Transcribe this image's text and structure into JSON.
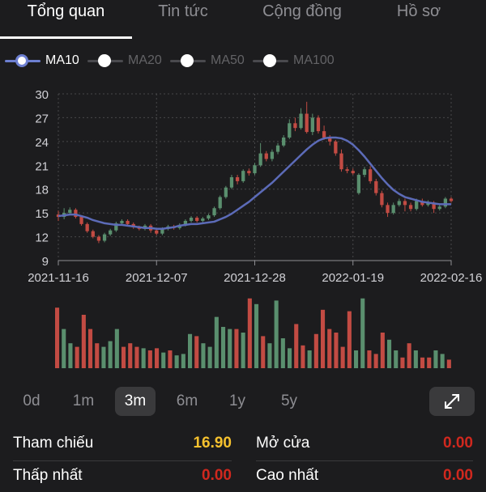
{
  "tabs": [
    {
      "label": "Tổng quan",
      "active": true
    },
    {
      "label": "Tin tức",
      "active": false
    },
    {
      "label": "Cộng đồng",
      "active": false
    },
    {
      "label": "Hồ sơ",
      "active": false
    }
  ],
  "legend": [
    {
      "label": "MA10",
      "on": true
    },
    {
      "label": "MA20",
      "on": false
    },
    {
      "label": "MA50",
      "on": false
    },
    {
      "label": "MA100",
      "on": false
    }
  ],
  "colors": {
    "up": "#5a8f6e",
    "down": "#c24b43",
    "ma": "#5c6bb8",
    "accent_yellow": "#f5c12e",
    "value_red": "#d0281e"
  },
  "chart_data": {
    "type": "candlestick",
    "y_ticks": [
      9,
      12,
      15,
      18,
      21,
      24,
      27,
      30
    ],
    "ylim": [
      9,
      30
    ],
    "x_tick_labels": [
      "2021-11-16",
      "2021-12-07",
      "2021-12-28",
      "2022-01-19",
      "2022-02-16"
    ],
    "grid": true,
    "candles": [
      [
        14.8,
        14.5,
        15.3,
        14.0
      ],
      [
        14.5,
        15.0,
        15.6,
        14.2
      ],
      [
        15.0,
        15.4,
        15.7,
        14.8
      ],
      [
        15.4,
        14.5,
        15.6,
        14.3
      ],
      [
        14.5,
        13.6,
        14.7,
        13.4
      ],
      [
        13.6,
        12.7,
        13.8,
        12.5
      ],
      [
        12.7,
        12.0,
        12.9,
        11.8
      ],
      [
        12.0,
        11.5,
        12.2,
        11.2
      ],
      [
        11.5,
        12.3,
        12.5,
        11.3
      ],
      [
        12.3,
        12.8,
        13.0,
        12.1
      ],
      [
        12.8,
        13.7,
        13.9,
        12.6
      ],
      [
        13.7,
        14.0,
        14.2,
        13.4
      ],
      [
        14.0,
        13.6,
        14.2,
        13.4
      ],
      [
        13.6,
        13.2,
        13.8,
        13.0
      ],
      [
        13.2,
        13.0,
        13.4,
        12.8
      ],
      [
        13.0,
        13.4,
        13.6,
        12.8
      ],
      [
        13.4,
        12.8,
        13.6,
        12.5
      ],
      [
        12.8,
        12.4,
        13.0,
        12.2
      ],
      [
        12.4,
        13.0,
        13.2,
        12.2
      ],
      [
        13.0,
        13.3,
        13.5,
        12.8
      ],
      [
        13.3,
        13.1,
        13.5,
        12.9
      ],
      [
        13.1,
        13.5,
        13.7,
        12.9
      ],
      [
        13.5,
        14.0,
        14.2,
        13.3
      ],
      [
        14.0,
        14.4,
        14.6,
        13.8
      ],
      [
        14.4,
        14.0,
        14.6,
        13.8
      ],
      [
        14.0,
        14.3,
        14.5,
        13.8
      ],
      [
        14.3,
        14.7,
        14.9,
        14.1
      ],
      [
        14.7,
        15.6,
        15.8,
        14.5
      ],
      [
        15.6,
        17.0,
        17.2,
        15.4
      ],
      [
        17.0,
        18.2,
        18.4,
        16.8
      ],
      [
        18.2,
        19.5,
        19.8,
        18.0
      ],
      [
        19.5,
        19.0,
        19.8,
        18.6
      ],
      [
        19.0,
        20.3,
        20.5,
        18.8
      ],
      [
        20.3,
        20.0,
        20.6,
        19.7
      ],
      [
        20.0,
        21.0,
        21.3,
        19.8
      ],
      [
        21.0,
        22.5,
        23.8,
        20.8
      ],
      [
        22.5,
        21.8,
        22.8,
        21.5
      ],
      [
        21.8,
        22.7,
        23.0,
        21.5
      ],
      [
        22.7,
        23.5,
        23.8,
        22.4
      ],
      [
        23.5,
        24.5,
        24.8,
        23.3
      ],
      [
        24.5,
        26.3,
        26.8,
        24.3
      ],
      [
        26.3,
        25.7,
        27.0,
        25.3
      ],
      [
        25.7,
        27.5,
        28.2,
        25.5
      ],
      [
        27.5,
        25.2,
        29.0,
        25.0
      ],
      [
        25.2,
        27.0,
        27.5,
        24.8
      ],
      [
        27.0,
        25.3,
        27.3,
        25.0
      ],
      [
        25.3,
        24.5,
        26.0,
        24.2
      ],
      [
        24.5,
        24.0,
        24.8,
        23.5
      ],
      [
        24.0,
        22.5,
        24.2,
        22.2
      ],
      [
        22.5,
        20.5,
        23.0,
        20.2
      ],
      [
        20.5,
        20.3,
        20.8,
        20.0
      ],
      [
        20.3,
        20.0,
        20.6,
        19.8
      ],
      [
        17.5,
        19.8,
        20.0,
        17.3
      ],
      [
        19.8,
        20.5,
        20.8,
        19.5
      ],
      [
        20.5,
        19.0,
        20.9,
        18.7
      ],
      [
        19.0,
        17.5,
        19.3,
        17.2
      ],
      [
        17.5,
        16.0,
        17.8,
        15.7
      ],
      [
        16.0,
        15.0,
        16.3,
        14.5
      ],
      [
        15.0,
        16.0,
        16.3,
        14.8
      ],
      [
        16.0,
        16.5,
        16.8,
        15.8
      ],
      [
        16.5,
        16.0,
        16.8,
        15.2
      ],
      [
        16.0,
        15.5,
        16.3,
        15.2
      ],
      [
        15.5,
        16.5,
        16.8,
        15.3
      ],
      [
        16.5,
        16.0,
        16.8,
        15.8
      ],
      [
        16.0,
        16.3,
        16.6,
        15.8
      ],
      [
        16.3,
        15.5,
        16.5,
        15.0
      ],
      [
        15.5,
        15.8,
        16.2,
        15.3
      ],
      [
        15.8,
        16.8,
        17.0,
        15.6
      ],
      [
        16.8,
        16.5,
        17.0,
        16.3
      ]
    ],
    "ma10": [
      14.6,
      14.7,
      14.8,
      14.8,
      14.6,
      14.4,
      14.1,
      13.9,
      13.7,
      13.6,
      13.5,
      13.5,
      13.4,
      13.3,
      13.2,
      13.1,
      13.1,
      13.0,
      13.0,
      13.1,
      13.2,
      13.4,
      13.5,
      13.6,
      13.6,
      13.7,
      13.8,
      13.9,
      14.2,
      14.5,
      14.9,
      15.4,
      15.9,
      16.4,
      17.0,
      17.6,
      18.2,
      18.8,
      19.5,
      20.2,
      20.9,
      21.6,
      22.3,
      23.0,
      23.6,
      24.1,
      24.4,
      24.5,
      24.5,
      24.4,
      24.1,
      23.6,
      22.9,
      22.1,
      21.2,
      20.3,
      19.4,
      18.6,
      17.9,
      17.4,
      17.0,
      16.8,
      16.6,
      16.4,
      16.3,
      16.2,
      16.1,
      16.1,
      16.1
    ],
    "volume": [
      0.85,
      0.55,
      0.35,
      0.3,
      0.75,
      0.55,
      0.35,
      0.3,
      0.38,
      0.55,
      0.3,
      0.35,
      0.3,
      0.28,
      0.25,
      0.28,
      0.22,
      0.25,
      0.18,
      0.2,
      0.48,
      0.45,
      0.35,
      0.3,
      0.72,
      0.58,
      0.55,
      0.55,
      0.5,
      0.98,
      0.9,
      0.45,
      0.35,
      0.95,
      0.42,
      0.28,
      0.62,
      0.32,
      0.25,
      0.48,
      0.82,
      0.55,
      0.5,
      0.3,
      0.8,
      0.25,
      0.98,
      0.25,
      0.2,
      0.5,
      0.4,
      0.25,
      0.15,
      0.35,
      0.25,
      0.15,
      0.15,
      0.25,
      0.2,
      0.12
    ]
  },
  "ranges": [
    {
      "label": "0d",
      "active": false
    },
    {
      "label": "1m",
      "active": false
    },
    {
      "label": "3m",
      "active": true
    },
    {
      "label": "6m",
      "active": false
    },
    {
      "label": "1y",
      "active": false
    },
    {
      "label": "5y",
      "active": false
    }
  ],
  "expand_icon": "expand-diagonal-icon",
  "stats": {
    "ref_label": "Tham chiếu",
    "ref_value": "16.90",
    "open_label": "Mở cửa",
    "open_value": "0.00",
    "low_label": "Thấp nhất",
    "low_value": "0.00",
    "high_label": "Cao nhất",
    "high_value": "0.00"
  }
}
